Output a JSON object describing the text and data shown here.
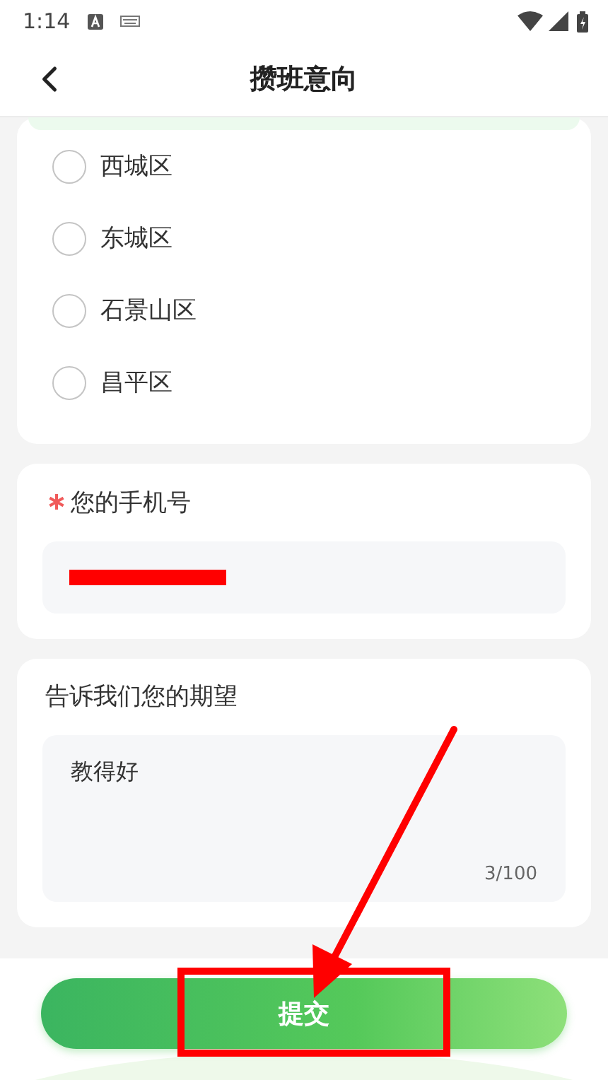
{
  "status_bar": {
    "time": "1:14"
  },
  "header": {
    "title": "攒班意向"
  },
  "district_options": [
    {
      "label": "西城区",
      "selected": false
    },
    {
      "label": "东城区",
      "selected": false
    },
    {
      "label": "石景山区",
      "selected": false
    },
    {
      "label": "昌平区",
      "selected": false
    }
  ],
  "phone_section": {
    "label": "您的手机号",
    "required": true
  },
  "expectation_section": {
    "label": "告诉我们您的期望",
    "value": "教得好",
    "counter": "3/100"
  },
  "submit_button": {
    "label": "提交"
  }
}
